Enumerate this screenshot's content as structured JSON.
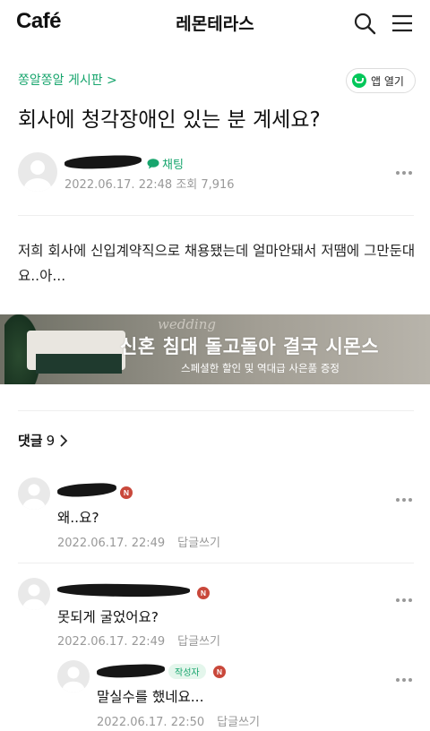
{
  "header": {
    "logo": "Café",
    "cafe_name": "레몬테라스",
    "icons": [
      "search-icon",
      "menu-icon"
    ]
  },
  "post": {
    "board": "쫑알쫑알 게시판 >",
    "app_open_label": "앱 열기",
    "title": "회사에 청각장애인 있는 분 계세요?",
    "chat_label": "채팅",
    "date": "2022.06.17. 22:48",
    "views": "조회 7,916",
    "body": "저희 회사에 신입계약직으로 채용됐는데 얼마안돼서 저땜에 그만둔대요..아..."
  },
  "ad": {
    "script_text": "wedding",
    "headline": "신혼 침대 돌고돌아 결국 시몬스",
    "subtext": "스페셜한 할인 및 역대급 사은품 증정"
  },
  "comments_section": {
    "label": "댓글",
    "count": "9"
  },
  "comments": [
    {
      "text": "왜..요?",
      "date": "2022.06.17. 22:49",
      "reply_label": "답글쓰기",
      "badge": "N"
    },
    {
      "text": "못되게 굴었어요?",
      "date": "2022.06.17. 22:49",
      "reply_label": "답글쓰기",
      "badge": "N"
    },
    {
      "text": "말실수를 했네요...",
      "date": "2022.06.17. 22:50",
      "reply_label": "답글쓰기",
      "writer_badge": "작성자",
      "badge": "N"
    }
  ],
  "colors": {
    "accent_green": "#17a56d",
    "naver_green": "#03c75a",
    "badge_red": "#c9483b"
  }
}
